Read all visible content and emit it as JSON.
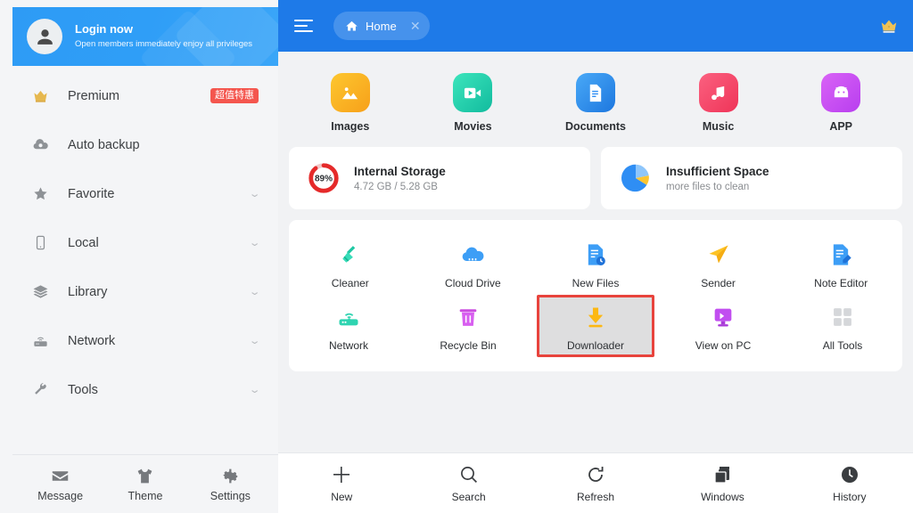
{
  "sidebar": {
    "login": {
      "title": "Login now",
      "subtitle": "Open members immediately enjoy all privileges",
      "avatar_icon": "user-avatar-icon"
    },
    "items": [
      {
        "label": "Premium",
        "icon": "crown-icon",
        "badge": "超值特惠",
        "chevron": false
      },
      {
        "label": "Auto backup",
        "icon": "cloud-backup-icon",
        "badge": null,
        "chevron": false
      },
      {
        "label": "Favorite",
        "icon": "star-icon",
        "badge": null,
        "chevron": true
      },
      {
        "label": "Local",
        "icon": "phone-icon",
        "badge": null,
        "chevron": true
      },
      {
        "label": "Library",
        "icon": "layers-icon",
        "badge": null,
        "chevron": true
      },
      {
        "label": "Network",
        "icon": "router-icon",
        "badge": null,
        "chevron": true
      },
      {
        "label": "Tools",
        "icon": "wrench-icon",
        "badge": null,
        "chevron": true
      }
    ],
    "bottom": [
      {
        "label": "Message",
        "icon": "envelope-icon"
      },
      {
        "label": "Theme",
        "icon": "tshirt-icon"
      },
      {
        "label": "Settings",
        "icon": "gear-icon"
      }
    ]
  },
  "topbar": {
    "menu_icon": "hamburger-icon",
    "tab": {
      "label": "Home",
      "icon": "home-icon",
      "close_icon": "close-icon"
    },
    "crown_icon": "crown-icon",
    "background_color": "#1e7ae8"
  },
  "categories": [
    {
      "label": "Images",
      "icon": "image-icon",
      "color_from": "#fdc72f",
      "color_to": "#f8a61c"
    },
    {
      "label": "Movies",
      "icon": "video-icon",
      "color_from": "#35e0b5",
      "color_to": "#16bfa0"
    },
    {
      "label": "Documents",
      "icon": "document-icon",
      "color_from": "#3fa4f6",
      "color_to": "#1f7ae0"
    },
    {
      "label": "Music",
      "icon": "music-note-icon",
      "color_from": "#fa5a76",
      "color_to": "#f0395c"
    },
    {
      "label": "APP",
      "icon": "android-icon",
      "color_from": "#d55ef5",
      "color_to": "#bb3ff0"
    }
  ],
  "cards": [
    {
      "title": "Internal Storage",
      "subtitle": "4.72 GB / 5.28 GB",
      "icon": "storage-donut-icon",
      "percent": "89%",
      "percent_value": 89,
      "accent_color": "#e52a2a"
    },
    {
      "title": "Insufficient Space",
      "subtitle": "more files to clean",
      "icon": "pie-chart-icon",
      "accent_color": "#2f8ef4"
    }
  ],
  "tools": {
    "row1": [
      {
        "label": "Cleaner",
        "icon": "broom-icon",
        "highlighted": false
      },
      {
        "label": "Cloud Drive",
        "icon": "cloud-icon",
        "highlighted": false
      },
      {
        "label": "New Files",
        "icon": "new-file-icon",
        "highlighted": false
      },
      {
        "label": "Sender",
        "icon": "paper-plane-icon",
        "highlighted": false
      },
      {
        "label": "Note Editor",
        "icon": "note-edit-icon",
        "highlighted": false
      }
    ],
    "row2": [
      {
        "label": "Network",
        "icon": "wifi-router-icon",
        "highlighted": false
      },
      {
        "label": "Recycle Bin",
        "icon": "trash-icon",
        "highlighted": false
      },
      {
        "label": "Downloader",
        "icon": "download-icon",
        "highlighted": true
      },
      {
        "label": "View on PC",
        "icon": "monitor-icon",
        "highlighted": false
      },
      {
        "label": "All Tools",
        "icon": "grid-icon",
        "highlighted": false
      }
    ],
    "highlight_color": "#e8433c"
  },
  "bottombar": [
    {
      "label": "New",
      "icon": "plus-icon"
    },
    {
      "label": "Search",
      "icon": "search-icon"
    },
    {
      "label": "Refresh",
      "icon": "refresh-icon"
    },
    {
      "label": "Windows",
      "icon": "windows-stack-icon"
    },
    {
      "label": "History",
      "icon": "clock-icon"
    }
  ]
}
